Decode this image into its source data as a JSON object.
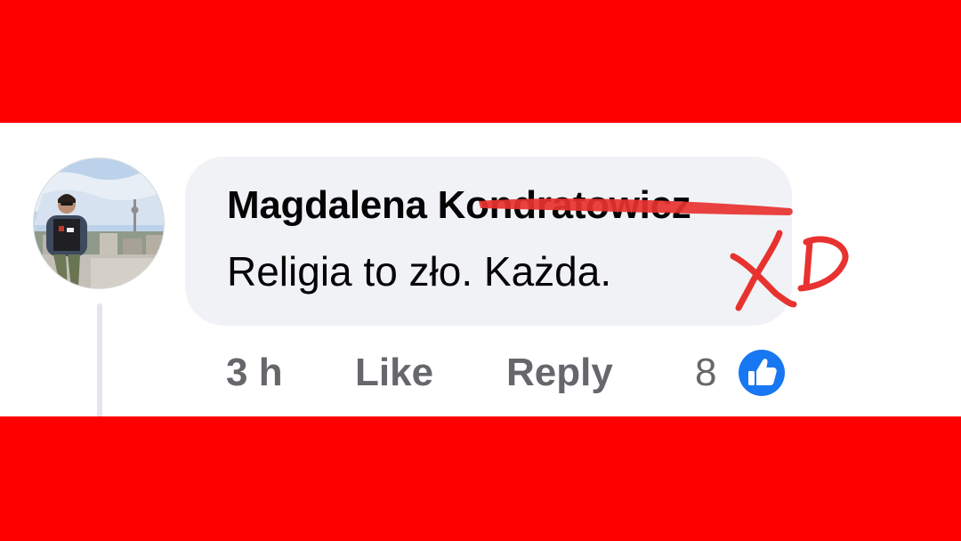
{
  "colors": {
    "band": "#ff0000",
    "bubble": "#f0f2f5",
    "text": "#050505",
    "muted": "#65676b",
    "like_blue": "#1877f2",
    "strike_red": "#e8322f",
    "scribble_red": "#e8322f"
  },
  "comment": {
    "author": "Magdalena Kondratowicz",
    "text": "Religia to zło. Każda.",
    "time": "3 h",
    "like_label": "Like",
    "reply_label": "Reply",
    "reaction_count": "8"
  },
  "overlay": {
    "scribble_text": "XD"
  },
  "icons": {
    "reaction": "thumbs-up-icon",
    "avatar": "profile-photo"
  }
}
